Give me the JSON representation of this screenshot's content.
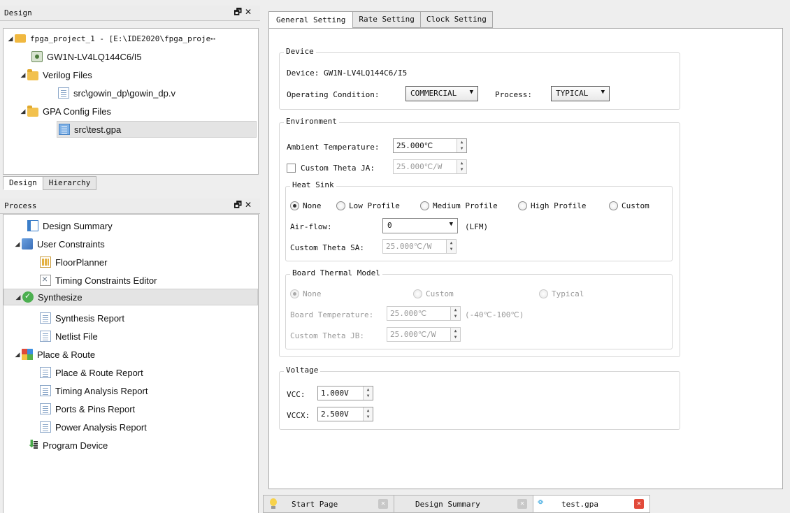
{
  "design_panel": {
    "title": "Design",
    "tree": [
      {
        "label": "fpga_project_1 - [E:\\IDE2020\\fpga_proje⋯",
        "depth": 0,
        "icon": "project-folder-icon",
        "expanded": true
      },
      {
        "label": "GW1N-LV4LQ144C6/I5",
        "depth": 1,
        "icon": "chip-icon"
      },
      {
        "label": "Verilog Files",
        "depth": 1,
        "icon": "folder-icon",
        "expanded": true
      },
      {
        "label": "src\\gowin_dp\\gowin_dp.v",
        "depth": 2,
        "icon": "file-icon"
      },
      {
        "label": "GPA Config Files",
        "depth": 1,
        "icon": "folder-icon",
        "expanded": true
      },
      {
        "label": "src\\test.gpa",
        "depth": 2,
        "icon": "gpa-file-icon",
        "selected": true
      }
    ],
    "tabs": [
      "Design",
      "Hierarchy"
    ]
  },
  "process_panel": {
    "title": "Process",
    "items": [
      {
        "label": "Design Summary",
        "depth": 1
      },
      {
        "label": "User Constraints",
        "depth": 0
      },
      {
        "label": "FloorPlanner",
        "depth": 1
      },
      {
        "label": "Timing Constraints Editor",
        "depth": 1
      },
      {
        "label": "Synthesize",
        "depth": 0
      },
      {
        "label": "Synthesis Report",
        "depth": 1
      },
      {
        "label": "Netlist File",
        "depth": 1
      },
      {
        "label": "Place & Route",
        "depth": 0
      },
      {
        "label": "Place & Route Report",
        "depth": 1
      },
      {
        "label": "Timing Analysis Report",
        "depth": 1
      },
      {
        "label": "Ports & Pins Report",
        "depth": 1
      },
      {
        "label": "Power Analysis Report",
        "depth": 1
      },
      {
        "label": "Program Device",
        "depth": 0
      }
    ]
  },
  "tabs": [
    "General Setting",
    "Rate Setting",
    "Clock Setting"
  ],
  "device": {
    "group": "Device",
    "device_text": "Device: GW1N-LV4LQ144C6/I5",
    "operating_label": "Operating Condition:",
    "operating_value": "COMMERCIAL",
    "process_label": "Process:",
    "process_value": "TYPICAL"
  },
  "environment": {
    "group": "Environment",
    "ambient_label": "Ambient Temperature:",
    "ambient_value": "25.000℃",
    "theta_ja_label": "Custom Theta JA:",
    "theta_ja_value": "25.000℃/W",
    "heat_sink": {
      "group": "Heat Sink",
      "options": [
        "None",
        "Low Profile",
        "Medium Profile",
        "High Profile",
        "Custom"
      ],
      "selected": "None",
      "airflow_label": "Air-flow:",
      "airflow_value": "0",
      "airflow_unit": "(LFM)",
      "theta_sa_label": "Custom Theta SA:",
      "theta_sa_value": "25.000℃/W"
    },
    "board": {
      "group": "Board Thermal Model",
      "options": [
        "None",
        "Custom",
        "Typical"
      ],
      "selected": "None",
      "temp_label": "Board Temperature:",
      "temp_value": "25.000℃",
      "temp_range": "(-40℃-100℃)",
      "theta_jb_label": "Custom Theta  JB:",
      "theta_jb_value": "25.000℃/W"
    }
  },
  "voltage": {
    "group": "Voltage",
    "vcc_label": "VCC:",
    "vcc_value": "1.000V",
    "vccx_label": "VCCX:",
    "vccx_value": "2.500V"
  },
  "bottom_tabs": [
    "Start Page",
    "Design Summary",
    "test.gpa"
  ]
}
